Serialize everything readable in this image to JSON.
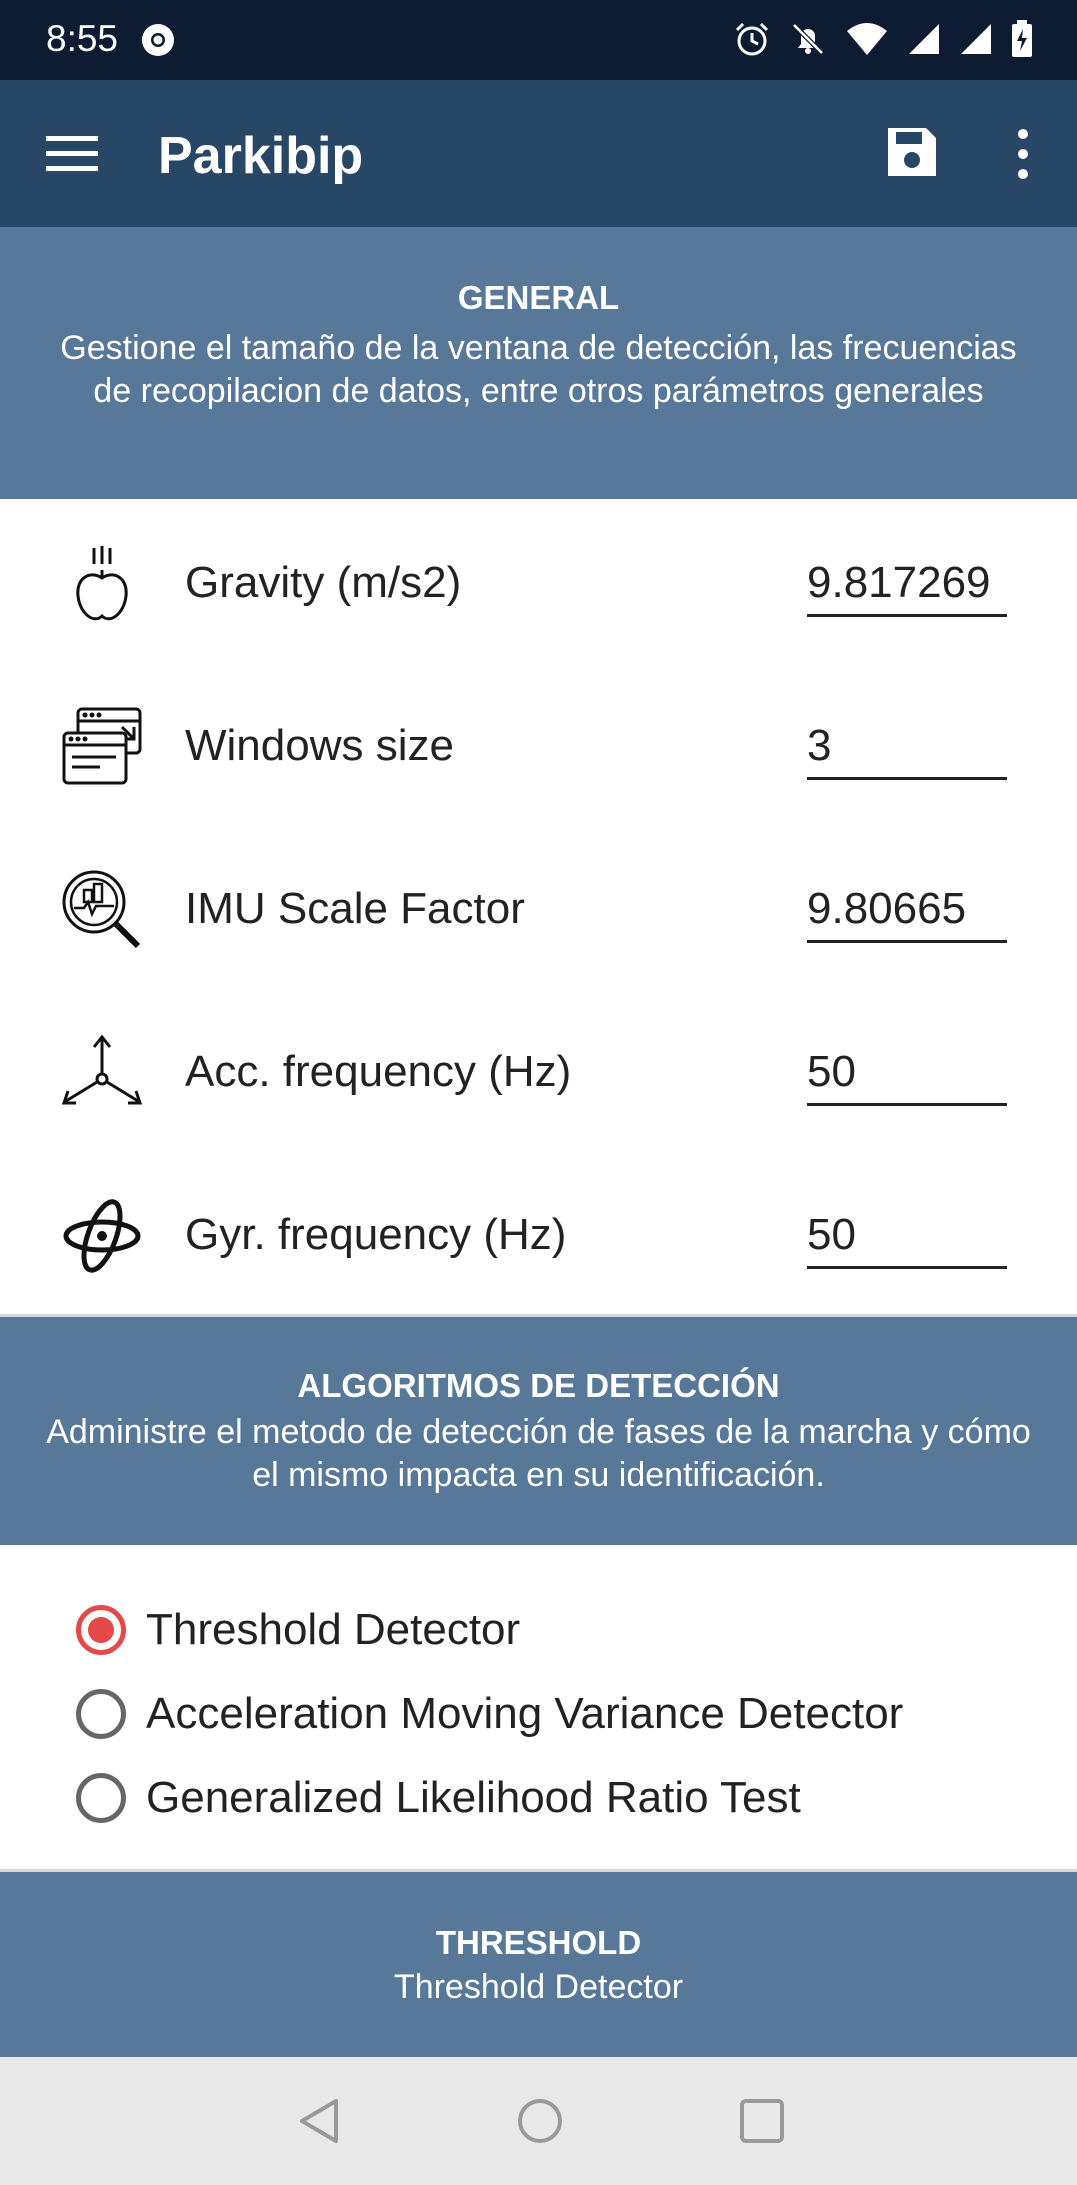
{
  "status_bar": {
    "time": "8:55",
    "icons": [
      "chrome-icon",
      "alarm-icon",
      "notifications-off-icon",
      "wifi-icon",
      "signal-icon",
      "battery-charging-icon"
    ]
  },
  "app_bar": {
    "title": "Parkibip",
    "icons": [
      "menu-icon",
      "save-icon",
      "more-vert-icon"
    ]
  },
  "general": {
    "title": "GENERAL",
    "description": "Gestione el tamaño de la ventana de detección, las frecuencias de recopilacion de datos, entre otros parámetros generales",
    "settings": [
      {
        "label": "Gravity (m/s2)",
        "value": "9.817269",
        "icon": "gravity-apple-icon"
      },
      {
        "label": "Windows size",
        "value": "3",
        "icon": "windows-size-icon"
      },
      {
        "label": "IMU Scale Factor",
        "value": "9.80665",
        "icon": "imu-scale-icon"
      },
      {
        "label": "Acc. frequency (Hz)",
        "value": "50",
        "icon": "accelerometer-axes-icon"
      },
      {
        "label": "Gyr. frequency (Hz)",
        "value": "50",
        "icon": "gyroscope-icon"
      }
    ]
  },
  "algorithms": {
    "title": "ALGORITMOS DE DETECCIÓN",
    "description": "Administre el metodo de detección de fases de la marcha y cómo el mismo impacta en su identificación.",
    "options": [
      {
        "label": "Threshold Detector",
        "selected": true
      },
      {
        "label": "Acceleration Moving Variance Detector",
        "selected": false
      },
      {
        "label": "Generalized Likelihood Ratio Test",
        "selected": false
      }
    ]
  },
  "threshold": {
    "title": "THRESHOLD",
    "subtitle": "Threshold Detector"
  },
  "nav_bar": {
    "icons": [
      "back-icon",
      "home-icon",
      "recents-icon"
    ]
  },
  "colors": {
    "status_bar": "#0d1c33",
    "app_bar": "#284766",
    "section_header": "#577898",
    "radio_accent": "#e54848",
    "nav_bar": "#e8e8e8"
  }
}
